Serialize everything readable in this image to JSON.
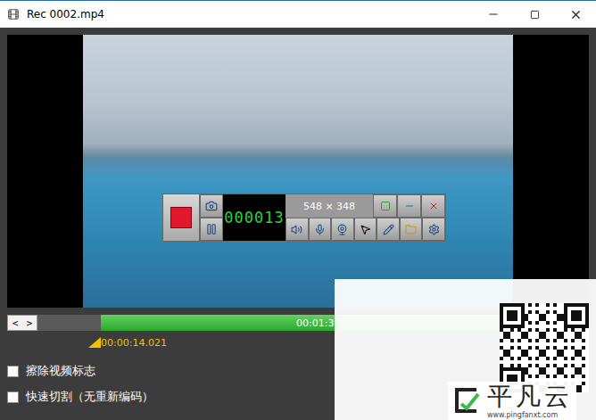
{
  "window": {
    "title": "Rec 0002.mp4"
  },
  "video": {
    "recorder_toolbar": {
      "counter": "000013",
      "size": "548 × 348",
      "recording": true
    }
  },
  "timeline": {
    "nav_buttons": [
      "<",
      ">"
    ],
    "selection_start": 0.115,
    "selection_end": 1,
    "end_time": "00:01:3",
    "marker_time": "00:00:14.021"
  },
  "options": [
    {
      "label": "擦除视频标志",
      "checked": false
    },
    {
      "label": "快速切割（无重新编码）",
      "checked": false
    }
  ],
  "watermark": {
    "brand": "平凡云",
    "url": "www.pingfanxt.com"
  }
}
